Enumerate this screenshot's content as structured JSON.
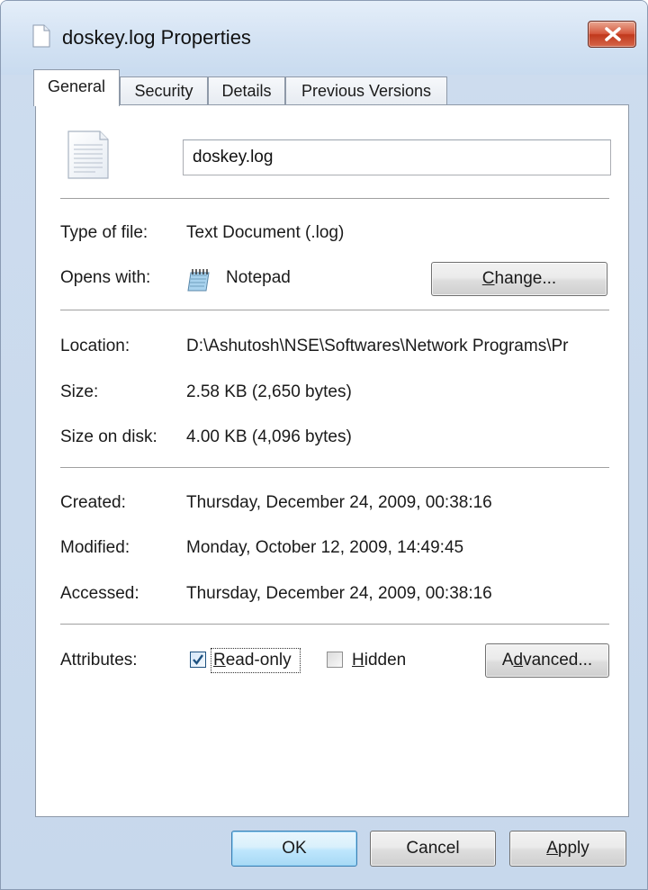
{
  "window": {
    "title": "doskey.log Properties"
  },
  "tabs": [
    {
      "label": "General",
      "active": true
    },
    {
      "label": "Security",
      "active": false
    },
    {
      "label": "Details",
      "active": false
    },
    {
      "label": "Previous Versions",
      "active": false
    }
  ],
  "general": {
    "file_name": "doskey.log",
    "type_label": "Type of file:",
    "type_value": "Text Document (.log)",
    "opens_label": "Opens with:",
    "opens_value": "Notepad",
    "change_button": {
      "prefix": "",
      "accel": "C",
      "suffix": "hange..."
    },
    "location_label": "Location:",
    "location_value": "D:\\Ashutosh\\NSE\\Softwares\\Network Programs\\Pr",
    "size_label": "Size:",
    "size_value": "2.58 KB (2,650 bytes)",
    "size_on_disk_label": "Size on disk:",
    "size_on_disk_value": "4.00 KB (4,096 bytes)",
    "created_label": "Created:",
    "created_value": "Thursday, December 24, 2009, 00:38:16",
    "modified_label": "Modified:",
    "modified_value": "Monday, October 12, 2009, 14:49:45",
    "accessed_label": "Accessed:",
    "accessed_value": "Thursday, December 24, 2009, 00:38:16",
    "attributes_label": "Attributes:",
    "readonly": {
      "accel": "R",
      "rest": "ead-only",
      "checked": true
    },
    "hidden": {
      "accel": "H",
      "rest": "idden",
      "checked": false
    },
    "advanced_button": {
      "prefix": "A",
      "accel": "d",
      "suffix": "vanced..."
    }
  },
  "footer": {
    "ok_label": "OK",
    "cancel_label": "Cancel",
    "apply_button": {
      "accel": "A",
      "suffix": "pply"
    }
  },
  "colors": {
    "window_frame": "#c9dbef",
    "close_button": "#c0381c",
    "default_button_border": "#3c7fb1",
    "checkbox_check": "#1d5180"
  }
}
